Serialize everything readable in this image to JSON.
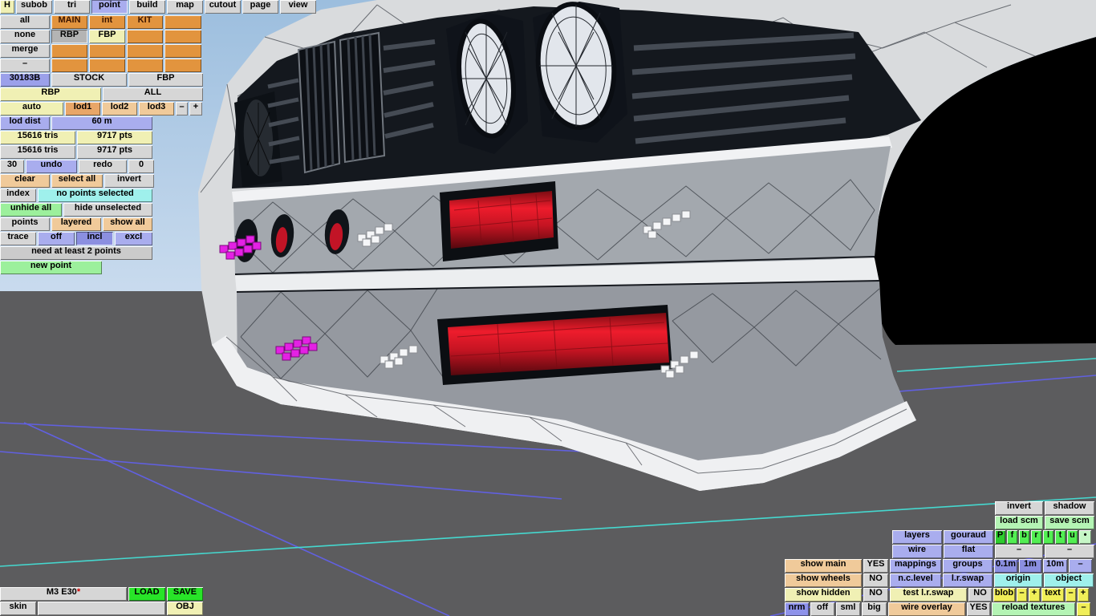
{
  "menu": {
    "h": "H",
    "subob": "subob",
    "tri": "tri",
    "point": "point",
    "build": "build",
    "map": "map",
    "cutout": "cutout",
    "page": "page",
    "view": "view"
  },
  "subob": {
    "all": "all",
    "none": "none",
    "merge": "merge",
    "dash": "–",
    "main": "MAIN",
    "int": "int",
    "kit": "KIT",
    "rbp": "RBP",
    "fbp": "FBP",
    "id": "30183B",
    "stock": "STOCK",
    "fbp_wide": "FBP",
    "rbp_wide": "RBP",
    "all_wide": "ALL"
  },
  "lod": {
    "auto": "auto",
    "lod1": "lod1",
    "lod2": "lod2",
    "lod3": "lod3",
    "minus": "–",
    "plus": "+",
    "dist_label": "lod dist",
    "dist_value": "60 m",
    "tris_a": "15616 tris",
    "pts_a": "9717 pts",
    "tris_b": "15616 tris",
    "pts_b": "9717 pts"
  },
  "edit": {
    "undo_count": "30",
    "undo": "undo",
    "redo": "redo",
    "redo_count": "0",
    "clear": "clear",
    "select_all": "select all",
    "invert": "invert",
    "index": "index",
    "status": "no points selected",
    "unhide_all": "unhide all",
    "hide_unselected": "hide unselected",
    "points": "points",
    "layered": "layered",
    "show_all": "show all",
    "trace": "trace",
    "off": "off",
    "incl": "incl",
    "excl": "excl",
    "hint": "need at least 2 points",
    "new_point": "new point"
  },
  "file": {
    "model_name": "M3 E30",
    "dirty_marker": "*",
    "load": "LOAD",
    "save": "SAVE",
    "skin": "skin",
    "obj": "OBJ"
  },
  "render": {
    "invert": "invert",
    "shadow": "shadow",
    "load_scm": "load scm",
    "save_scm": "save scm",
    "layers": "layers",
    "gouraud": "gouraud",
    "channels": [
      "P",
      "f",
      "b",
      "r",
      "l",
      "t",
      "u"
    ],
    "channel_dot": "•",
    "wire": "wire",
    "flat": "flat",
    "dash1": "–",
    "dash2": "–",
    "show_main": "show main",
    "show_main_val": "YES",
    "mappings": "mappings",
    "groups": "groups",
    "m01": "0.1m",
    "m1": "1m",
    "m10": "10m",
    "mdash": "–",
    "show_wheels": "show wheels",
    "show_wheels_val": "NO",
    "nclevel": "n.c.level",
    "lrswap": "l.r.swap",
    "origin": "origin",
    "object": "object",
    "show_hidden": "show hidden",
    "show_hidden_val": "NO",
    "test_lrswap": "test l.r.swap",
    "test_val": "NO",
    "blob": "blob",
    "blob_minus": "–",
    "blob_plus": "+",
    "text": "text",
    "text_minus": "–",
    "text_plus": "+",
    "nrm": "nrm",
    "off": "off",
    "sml": "sml",
    "big": "big",
    "wire_overlay": "wire overlay",
    "wire_overlay_val": "YES",
    "reload_textures": "reload textures",
    "corner_dash": "–"
  },
  "viewport": {
    "sky": "#a3c2e2",
    "ground": "#5c5c5e",
    "grid_line_blue": "#6160e0",
    "grid_line_cyan": "#45d8cf",
    "body": "#d9dbdd",
    "pipe_red": "#d31525",
    "marker_magenta": "#e421e4",
    "marker_white": "#f5f6f8",
    "hole_black": "#000000"
  },
  "ui_colors": {
    "panel_gray": "#d6d6d6",
    "panel_orange": "#e2943e",
    "pale_yellow": "#f0f0b4",
    "lavender": "#a9adee",
    "peach": "#f0ca9a",
    "cyan": "#9ff0ec",
    "green": "#9cf09c",
    "bright_green": "#28e428",
    "yellow": "#f0ee58"
  }
}
